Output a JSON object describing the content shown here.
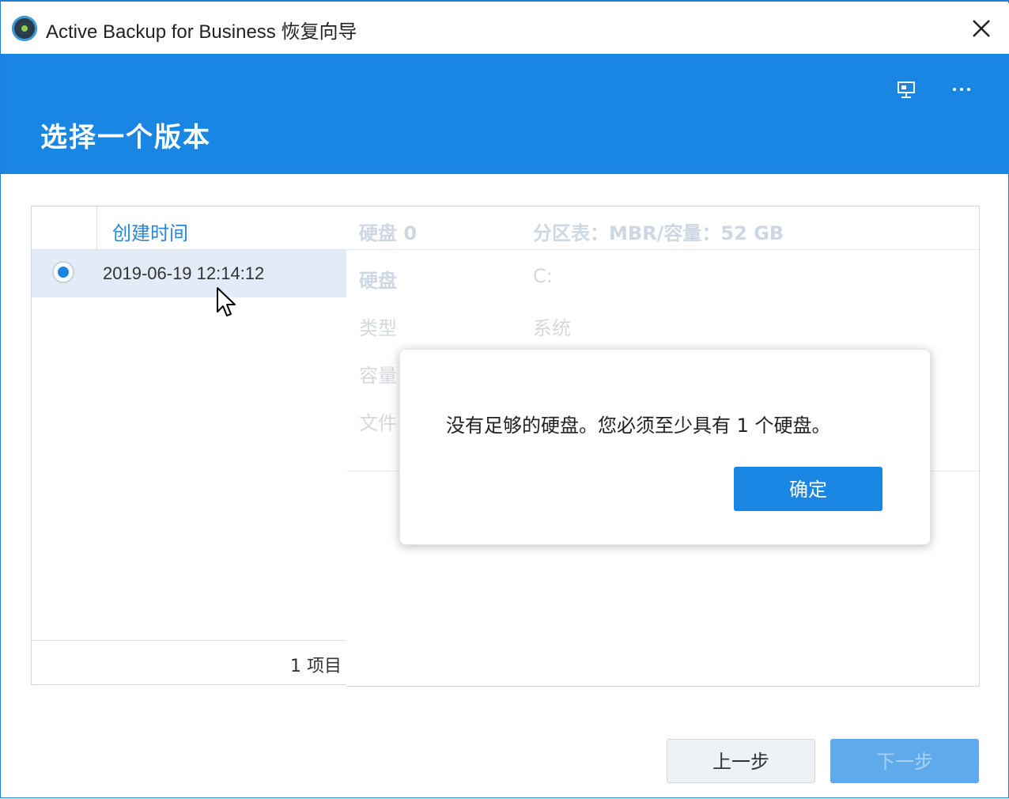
{
  "window": {
    "title": "Active Backup for Business 恢复向导"
  },
  "header": {
    "title": "选择一个版本"
  },
  "versions": {
    "column_header": "创建时间",
    "rows": [
      {
        "created": "2019-06-19 12:14:12",
        "selected": true
      }
    ],
    "count_label": "1 项目"
  },
  "details": {
    "disk_header": "硬盘 0",
    "partition_info": "分区表：MBR/容量：52 GB",
    "rows": [
      {
        "label": "硬盘",
        "value": "C:"
      },
      {
        "label": "类型",
        "value": "系统"
      },
      {
        "label": "容量",
        "value": ""
      },
      {
        "label": "文件",
        "value": ""
      }
    ]
  },
  "dialog": {
    "message": "没有足够的硬盘。您必须至少具有 1 个硬盘。",
    "ok_label": "确定"
  },
  "footer": {
    "prev_label": "上一步",
    "next_label": "下一步"
  },
  "colors": {
    "accent": "#1a86e3",
    "header_bg": "#1a86e3",
    "selected_row": "#e1ecf8",
    "disabled_button": "#5faaeb"
  }
}
